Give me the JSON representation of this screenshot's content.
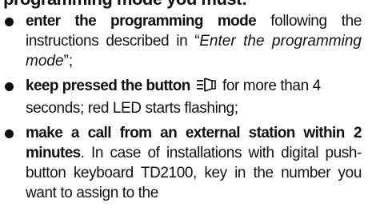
{
  "header": {
    "cut_text": "programming mode you must:"
  },
  "steps": [
    {
      "bold": "enter the programming mode",
      "text_before_quote": " following the instructions described in “",
      "quote_italic": "Enter the programming mode",
      "text_after_quote": "”;"
    },
    {
      "bold": "keep pressed the button",
      "icon": "door-lock-button-icon",
      "text": " for more than 4 seconds; red LED starts flashing;"
    },
    {
      "bold1": "make a call from an external station within",
      "bold2": "2 minutes",
      "text": ". In case of installations with digital push-button keyboard TD2100, key in the number you want to assign to the"
    }
  ]
}
